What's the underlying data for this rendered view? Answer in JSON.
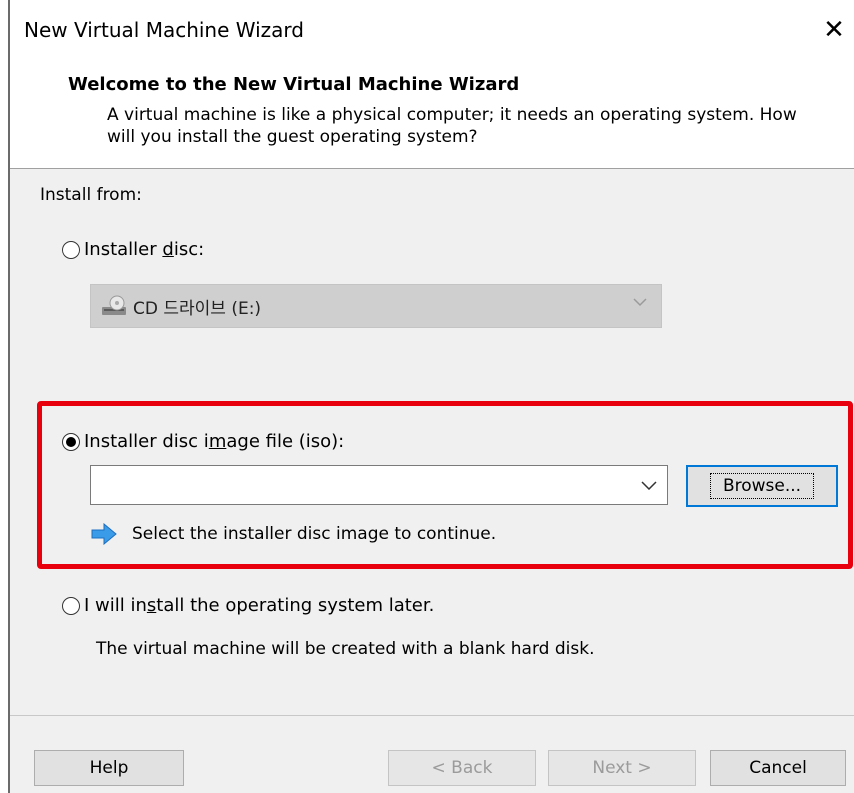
{
  "window": {
    "title": "New Virtual Machine Wizard",
    "close_glyph": "✕"
  },
  "header": {
    "title": "Welcome to the New Virtual Machine Wizard",
    "description": "A virtual machine is like a physical computer; it needs an operating system. How will you install the guest operating system?"
  },
  "install_from_label": "Install from:",
  "installer_disc": {
    "label_before": "Installer ",
    "label_mnemonic": "d",
    "label_after": "isc:",
    "selected": false,
    "drive_value": "CD 드라이브 (E:)",
    "drive_icon": "cd-drive-icon",
    "enabled": false
  },
  "installer_iso": {
    "label_before": "Installer disc i",
    "label_mnemonic": "m",
    "label_after": "age file (iso):",
    "selected": true,
    "path_value": "",
    "browse_label": "Browse...",
    "hint_icon": "info-arrow-icon",
    "hint_text": "Select the installer disc image to continue."
  },
  "install_later": {
    "label_before": "I will in",
    "label_mnemonic": "s",
    "label_after": "tall the operating system later.",
    "selected": false,
    "description": "The virtual machine will be created with a blank hard disk."
  },
  "buttons": {
    "help": "Help",
    "back": "< Back",
    "next": "Next >",
    "cancel": "Cancel"
  },
  "colors": {
    "highlight": "#e8000c",
    "accent": "#0078d7",
    "body_bg": "#f0f0f0"
  }
}
